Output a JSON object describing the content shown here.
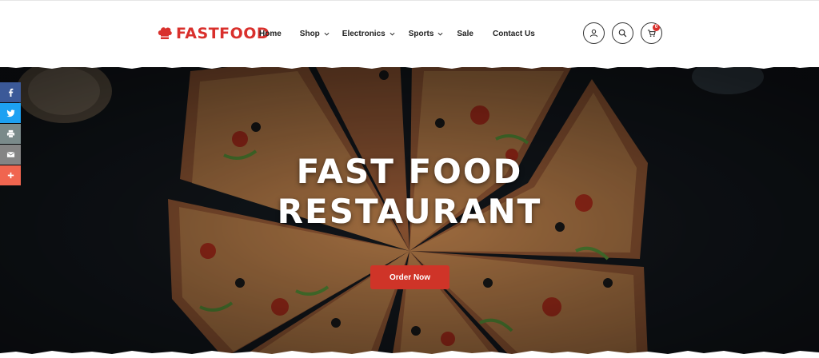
{
  "brand": {
    "name": "FASTFOOD",
    "color": "#d9302c"
  },
  "nav": {
    "items": [
      {
        "label": "Home",
        "dropdown": false
      },
      {
        "label": "Shop",
        "dropdown": true
      },
      {
        "label": "Electronics",
        "dropdown": true
      },
      {
        "label": "Sports",
        "dropdown": true
      },
      {
        "label": "Sale",
        "dropdown": false
      },
      {
        "label": "Contact Us",
        "dropdown": false
      }
    ]
  },
  "header_icons": {
    "account": "user-icon",
    "search": "search-icon",
    "cart": "cart-icon",
    "cart_count": "0"
  },
  "hero": {
    "title_line1": "FAST FOOD",
    "title_line2": "RESTAURANT",
    "cta_label": "Order Now",
    "cta_color": "#cf3428"
  },
  "share": {
    "items": [
      {
        "name": "facebook",
        "icon": "facebook-icon",
        "color": "#3b5998"
      },
      {
        "name": "twitter",
        "icon": "twitter-icon",
        "color": "#1da1f2"
      },
      {
        "name": "print",
        "icon": "print-icon",
        "color": "#7a8a8a"
      },
      {
        "name": "email",
        "icon": "email-icon",
        "color": "#848484"
      },
      {
        "name": "more",
        "icon": "plus-icon",
        "color": "#f0654f"
      }
    ]
  }
}
